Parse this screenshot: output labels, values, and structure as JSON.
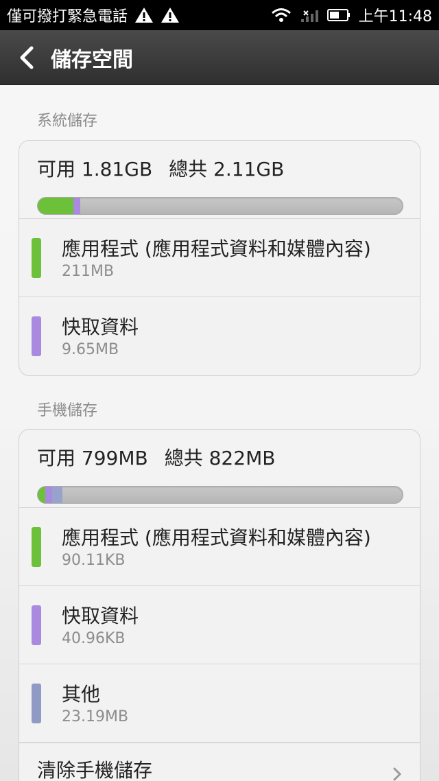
{
  "status_bar": {
    "carrier_text": "僅可撥打緊急電話",
    "time": "上午11:48",
    "icons": [
      "warning-icon",
      "warning-icon",
      "wifi-icon",
      "signal-icon",
      "battery-icon"
    ]
  },
  "header": {
    "title": "儲存空間",
    "back_icon": "back-arrow-icon"
  },
  "system_storage": {
    "section_title": "系統儲存",
    "available_label": "可用 1.81GB",
    "total_label": "總共 2.11GB",
    "usage": [
      {
        "name": "apps",
        "fraction": 0.098,
        "color": "#6cc03a"
      },
      {
        "name": "cache",
        "fraction": 0.018,
        "color": "#a98ae0"
      }
    ],
    "rows": [
      {
        "label": "應用程式 (應用程式資料和媒體內容)",
        "value": "211MB",
        "color": "#6cc03a"
      },
      {
        "label": "快取資料",
        "value": "9.65MB",
        "color": "#a98ae0"
      }
    ]
  },
  "phone_storage": {
    "section_title": "手機儲存",
    "available_label": "可用 799MB",
    "total_label": "總共 822MB",
    "usage": [
      {
        "name": "apps",
        "fraction": 0.02,
        "color": "#6cc03a"
      },
      {
        "name": "cache",
        "fraction": 0.02,
        "color": "#a98ae0"
      },
      {
        "name": "other",
        "fraction": 0.028,
        "color": "#98a3cc"
      }
    ],
    "rows": [
      {
        "label": "應用程式 (應用程式資料和媒體內容)",
        "value": "90.11KB",
        "color": "#6cc03a"
      },
      {
        "label": "快取資料",
        "value": "40.96KB",
        "color": "#a98ae0"
      },
      {
        "label": "其他",
        "value": "23.19MB",
        "color": "#8f9bc4"
      }
    ],
    "action_label": "清除手機儲存"
  }
}
